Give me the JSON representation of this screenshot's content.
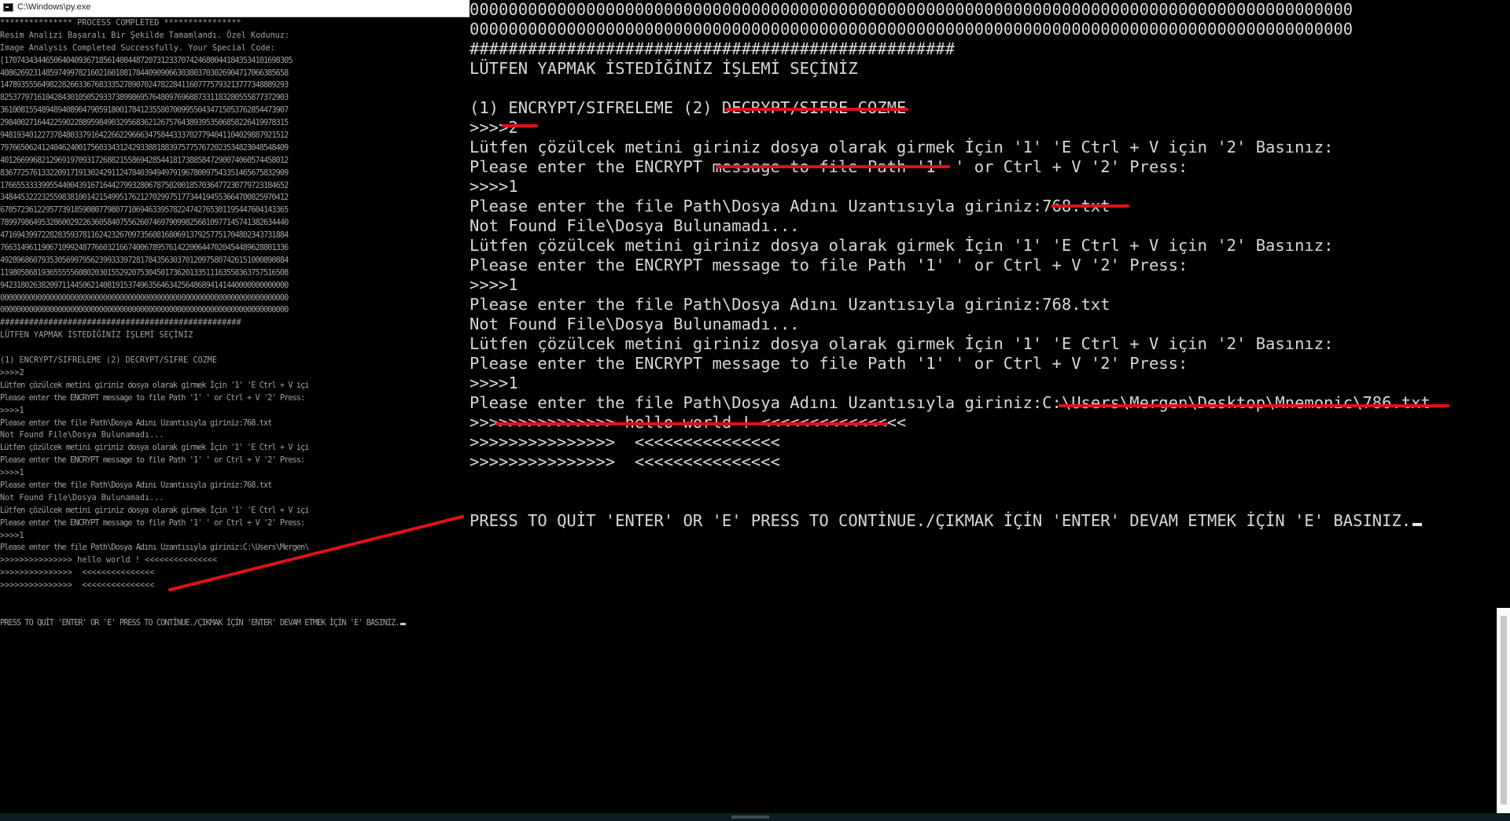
{
  "left_window": {
    "title": "C:\\Windows\\py.exe",
    "lines": [
      "*************** PROCESS COMPLETED ****************",
      "Resim Analizi Başaralı Bir Şekilde Tamamlandı. Özel Kodunuz:",
      "Image Analysis Completed Successfully. Your Special Code:",
      "[1707434344650640409367185614084487207312337074246800441843534101698305",
      "4086269231485974997821602160108178440909066303803703026904717066385658",
      "1478935556498228266336768333527890702478228411607775793213777348889293",
      "8253779716104284301050529337389986957648097696887331183280555877372903",
      "3610081554894894089047905918001784123558070099550434715053762854473907",
      "2984002716442259022889598490329568362126757643893953506858226419978315",
      "9481934012273784803379164226622966634758443337027794041104029887921512",
      "7976650624124046240017560334312429338818839757757672023534823048548409",
      "4012669968212969197093172688215586942854418173885847290074060574458012",
      "8367725761332209171913024291124784039494979196780097543351465675832909",
      "1766553333995544004391671644279932806787502001857036477230779723184652",
      "3484453222325598381001421549951762127029975177344194553664700825970412",
      "6705723612295773918590807798077106946339578224742765301195447604143365",
      "7899798649532860029226360584075562607469790998256810977145741382634440",
      "4716943997228283593781162423267097356081680691379257751704802343731884",
      "7663149611906710992487766032166740067895761422006447020454489628801336",
      "4928968607935305699795623993339728178435630370120975807426151000890884",
      "1198058681936555556080203015529207530450173620133511163558363757516508",
      "9423180263820971144506214081915374963564634256486894141440000000000000",
      "0000000000000000000000000000000000000000000000000000000000000000000000",
      "0000000000000000000000000000000000000000000000000000000000000000000000",
      "##################################################",
      "LÜTFEN YAPMAK İSTEDİĞİNİZ İŞLEMİ SEÇİNİZ",
      "",
      "(1) ENCRYPT/SIFRELEME (2) DECRYPT/SIFRE COZME",
      ">>>>2",
      "Lütfen çözülcek metini giriniz dosya olarak girmek İçin '1' 'E Ctrl + V içi",
      "Please enter the ENCRYPT message to file Path '1' ' or Ctrl + V '2' Press:",
      ">>>>1",
      "Please enter the file Path\\Dosya Adını Uzantısıyla giriniz:768.txt",
      "Not Found File\\Dosya Bulunamadı...",
      "Lütfen çözülcek metini giriniz dosya olarak girmek İçin '1' 'E Ctrl + V içi",
      "Please enter the ENCRYPT message to file Path '1' ' or Ctrl + V '2' Press:",
      ">>>>1",
      "Please enter the file Path\\Dosya Adını Uzantısıyla giriniz:768.txt",
      "Not Found File\\Dosya Bulunamadı...",
      "Lütfen çözülcek metini giriniz dosya olarak girmek İçin '1' 'E Ctrl + V içi",
      "Please enter the ENCRYPT message to file Path '1' ' or Ctrl + V '2' Press:",
      ">>>>1",
      "Please enter the file Path\\Dosya Adını Uzantısıyla giriniz:C:\\Users\\Mergen\\",
      ">>>>>>>>>>>>>>> hello world ! <<<<<<<<<<<<<<<",
      ">>>>>>>>>>>>>>>  <<<<<<<<<<<<<<<",
      ">>>>>>>>>>>>>>>  <<<<<<<<<<<<<<<",
      "",
      "",
      "PRESS TO QUİT 'ENTER' OR 'E' PRESS TO CONTİNUE./ÇIKMAK İÇİN 'ENTER' DEVAM ETMEK İÇİN 'E' BASINIZ."
    ]
  },
  "right_console": {
    "lines": [
      "0000000000000000000000000000000000000000000000000000000000000000000000000000000000000000000",
      "0000000000000000000000000000000000000000000000000000000000000000000000000000000000000000000",
      "##################################################",
      "LÜTFEN YAPMAK İSTEDİĞİNİZ İŞLEMİ SEÇİNİZ",
      "",
      "(1) ENCRYPT/SIFRELEME (2) DECRYPT/SIFRE COZME",
      ">>>>2",
      "Lütfen çözülcek metini giriniz dosya olarak girmek İçin '1' 'E Ctrl + V için '2' Basınız:",
      "Please enter the ENCRYPT message to file Path '1' ' or Ctrl + V '2' Press:",
      ">>>>1",
      "Please enter the file Path\\Dosya Adını Uzantısıyla giriniz:768.txt",
      "Not Found File\\Dosya Bulunamadı...",
      "Lütfen çözülcek metini giriniz dosya olarak girmek İçin '1' 'E Ctrl + V için '2' Basınız:",
      "Please enter the ENCRYPT message to file Path '1' ' or Ctrl + V '2' Press:",
      ">>>>1",
      "Please enter the file Path\\Dosya Adını Uzantısıyla giriniz:768.txt",
      "Not Found File\\Dosya Bulunamadı...",
      "Lütfen çözülcek metini giriniz dosya olarak girmek İçin '1' 'E Ctrl + V için '2' Basınız:",
      "Please enter the ENCRYPT message to file Path '1' ' or Ctrl + V '2' Press:",
      ">>>>1",
      "Please enter the file Path\\Dosya Adını Uzantısıyla giriniz:C:\\Users\\Mergen\\Desktop\\Mnemonic\\786.txt",
      ">>>>>>>>>>>>>>> hello world ! <<<<<<<<<<<<<<<",
      ">>>>>>>>>>>>>>>  <<<<<<<<<<<<<<<",
      ">>>>>>>>>>>>>>>  <<<<<<<<<<<<<<<",
      "",
      "",
      "PRESS TO QUİT 'ENTER' OR 'E' PRESS TO CONTİNUE./ÇIKMAK İÇİN 'ENTER' DEVAM ETMEK İÇİN 'E' BASINIZ."
    ]
  },
  "colors": {
    "background": "#000000",
    "text_right": "#d8d8d8",
    "text_left": "#a3a3a3",
    "annotation": "#e0101a"
  }
}
